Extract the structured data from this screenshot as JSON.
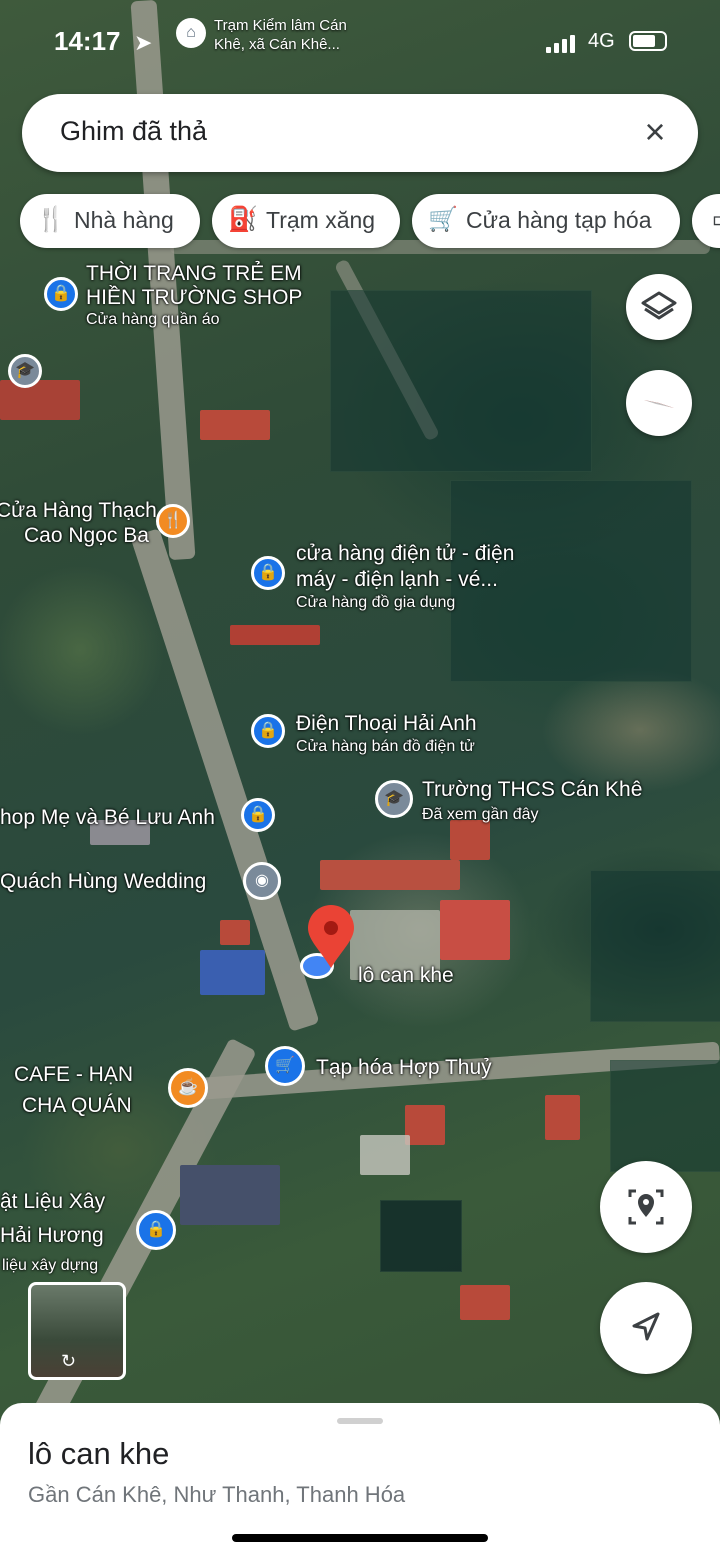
{
  "status_bar": {
    "time": "14:17",
    "nearby_place_line1": "Trạm Kiểm lâm Cán",
    "nearby_place_line2": "Khê, xã Cán Khê...",
    "network": "4G"
  },
  "search": {
    "value": "Ghim đã thả"
  },
  "chips": [
    {
      "label": "Nhà hàng",
      "icon": "restaurant-icon"
    },
    {
      "label": "Trạm xăng",
      "icon": "gas-station-icon"
    },
    {
      "label": "Cửa hàng tạp hóa",
      "icon": "shopping-cart-icon"
    }
  ],
  "map_labels": {
    "poi_kids_fashion_l1": "THỜI TRANG TRẺ EM",
    "poi_kids_fashion_l2": "HIỀN TRƯỜNG SHOP",
    "poi_kids_fashion_sub": "Cửa hàng quần áo",
    "poi_thach_l1": "Cửa Hàng Thạch",
    "poi_thach_l2": "Cao Ngọc Ba",
    "poi_electronics_l1": "cửa hàng điện tử - điện",
    "poi_electronics_l2": "máy - điện lạnh - vé...",
    "poi_electronics_sub": "Cửa hàng đồ gia dụng",
    "poi_phone": "Điện Thoại Hải Anh",
    "poi_phone_sub": "Cửa hàng bán đồ điện tử",
    "poi_school": "Trường THCS Cán Khê",
    "poi_school_sub": "Đã xem gần đây",
    "poi_mom_baby": "hop Mẹ và Bé Lưu Anh",
    "poi_wedding": "Quách Hùng Wedding",
    "dropped_pin_label": "lô can khe",
    "poi_grocery": "Tạp hóa Hợp Thuỷ",
    "poi_cafe_l1": "CAFE - HẠN",
    "poi_cafe_l2": "CHA QUÁN",
    "poi_building_l1": "ật Liệu Xây",
    "poi_building_l2": "Hải Hương",
    "poi_building_sub": "liệu xây dựng"
  },
  "sheet": {
    "title": "lô can khe",
    "subtitle": "Gần Cán Khê, Như Thanh, Thanh Hóa"
  },
  "colors": {
    "pin_red": "#ea4335",
    "poi_blue": "#1a73e8",
    "poi_orange": "#f28b22",
    "poi_gray": "#7a8a9a"
  }
}
